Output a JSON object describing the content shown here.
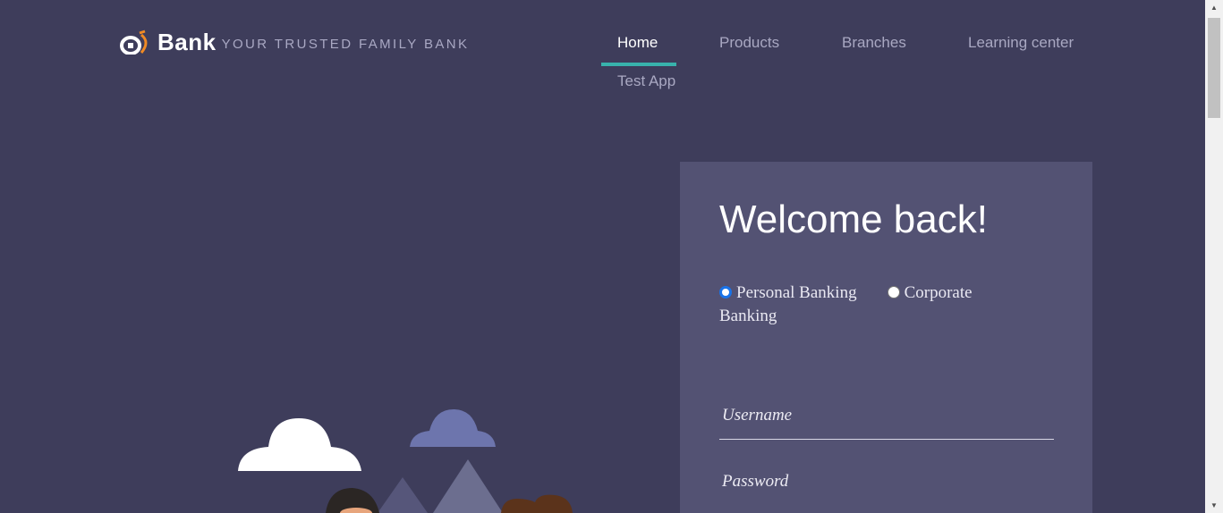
{
  "header": {
    "logo_text": "Bank",
    "tagline": "YOUR TRUSTED FAMILY BANK",
    "nav": [
      {
        "label": "Home",
        "active": true
      },
      {
        "label": "Products",
        "active": false
      },
      {
        "label": "Branches",
        "active": false
      },
      {
        "label": "Learning center",
        "active": false
      },
      {
        "label": "Test App",
        "active": false
      }
    ]
  },
  "login": {
    "title": "Welcome back!",
    "account_types": [
      {
        "label": "Personal Banking",
        "selected": true
      },
      {
        "label": "Corporate Banking",
        "selected": false
      }
    ],
    "username_placeholder": "Username",
    "password_placeholder": "Password"
  },
  "colors": {
    "background": "#3e3d5b",
    "card": "#535273",
    "accent": "#38b2ac",
    "logo_orange": "#f08a24"
  },
  "icons": {
    "logo": "bank-logo-icon",
    "illustration": "clouds-mountains-people-illustration"
  }
}
